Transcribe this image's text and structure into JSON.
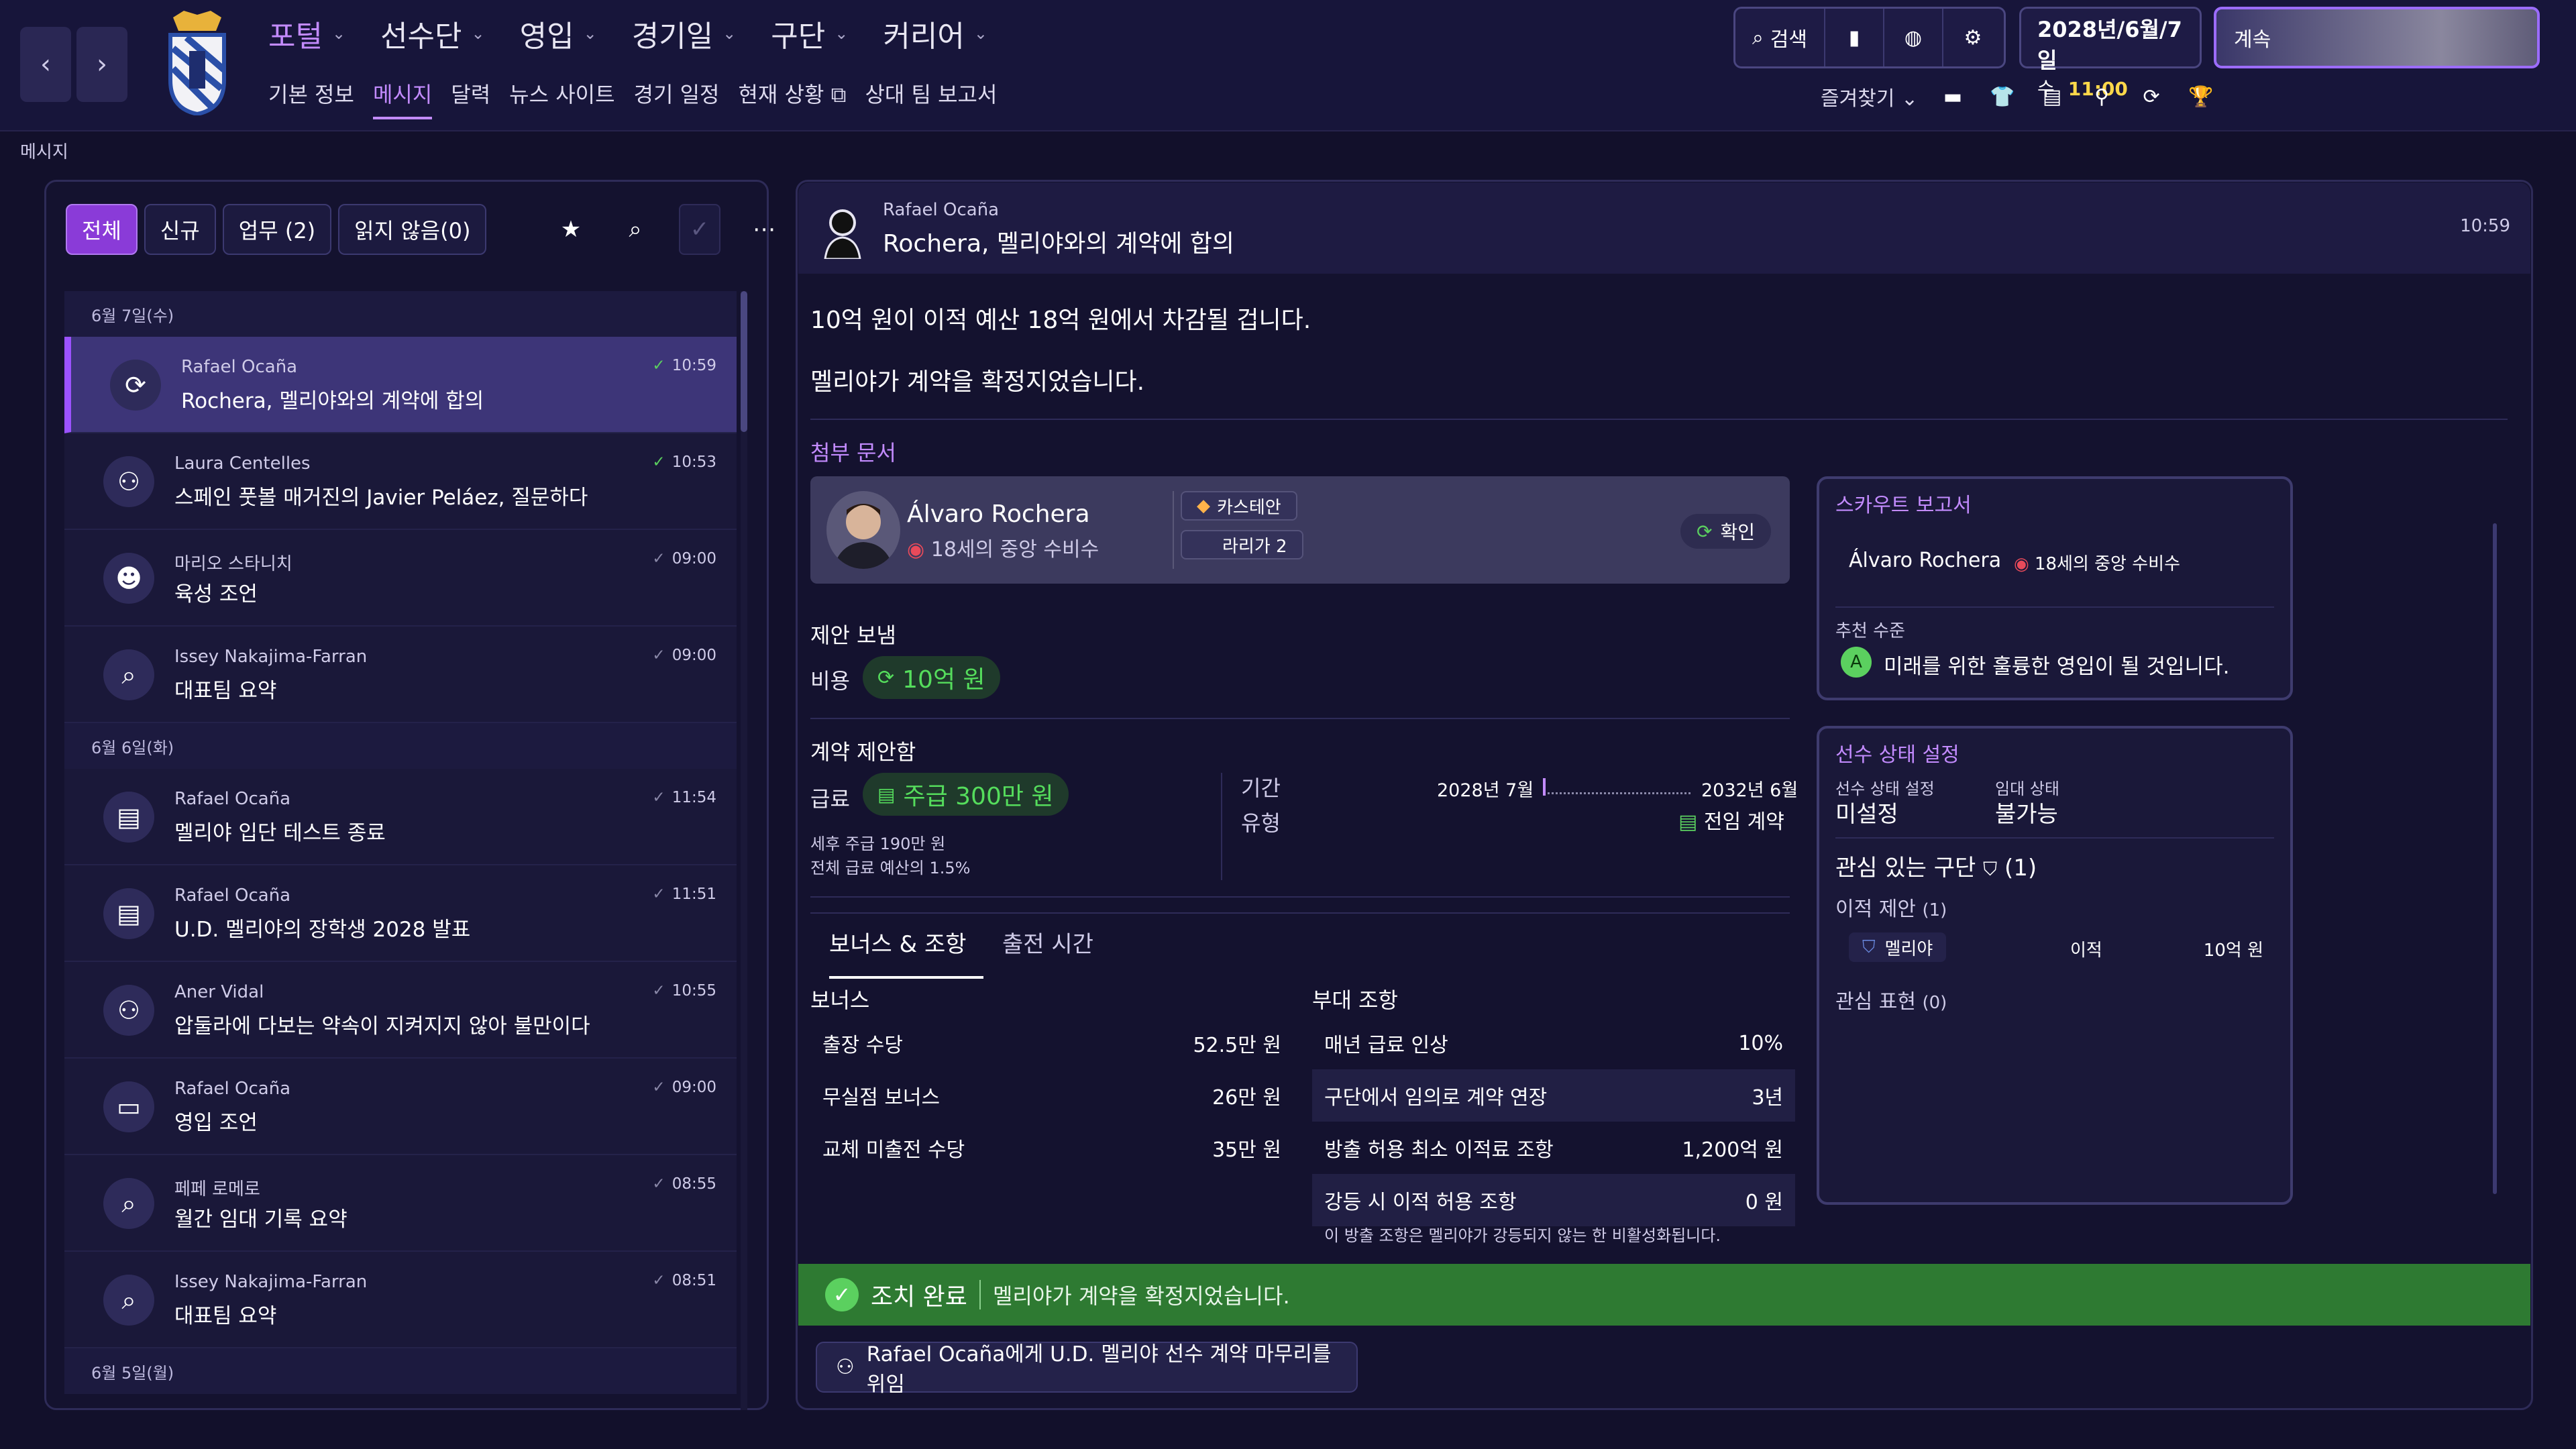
{
  "nav": {
    "back_icon": "chevron-left-icon",
    "forward_icon": "chevron-right-icon",
    "menu": [
      "포털",
      "선수단",
      "영입",
      "경기일",
      "구단",
      "커리어"
    ],
    "submenu": [
      "기본 정보",
      "메시지",
      "달력",
      "뉴스 사이트",
      "경기 일정",
      "현재 상황",
      "상대 팀 보고서"
    ],
    "search_label": "검색",
    "date": "2028년/6월/7일",
    "weekday": "수",
    "time": "11:00",
    "continue_label": "계속",
    "favorites_label": "즐겨찾기",
    "active_color": "#c38bff"
  },
  "breadcrumb": "메시지",
  "inbox": {
    "tabs": [
      "전체",
      "신규",
      "업무 (2)",
      "읽지 않음(0)"
    ],
    "days": [
      {
        "label": "6월 7일(수)",
        "items": [
          {
            "from": "Rafael Ocaña",
            "subject": "Rochera, 멜리야와의 계약에 합의",
            "time": "10:59",
            "icon": "refresh-icon",
            "read": "green",
            "selected": true
          },
          {
            "from": "Laura Centelles",
            "subject": "스페인 풋볼 매거진의 Javier Peláez, 질문하다",
            "time": "10:53",
            "icon": "press-icon",
            "read": "green"
          },
          {
            "from": "마리오 스타니치",
            "subject": "육성 조언",
            "time": "09:00",
            "icon": "group-icon",
            "read": "grey"
          },
          {
            "from": "Issey Nakajima-Farran",
            "subject": "대표팀 요약",
            "time": "09:00",
            "icon": "magnifier-icon",
            "read": "grey"
          }
        ]
      },
      {
        "label": "6월 6일(화)",
        "items": [
          {
            "from": "Rafael Ocaña",
            "subject": "멜리야 입단 테스트 종료",
            "time": "11:54",
            "icon": "document-icon",
            "read": "grey"
          },
          {
            "from": "Rafael Ocaña",
            "subject": "U.D. 멜리야의 장학생 2028 발표",
            "time": "11:51",
            "icon": "document-icon",
            "read": "grey"
          },
          {
            "from": "Aner Vidal",
            "subject": "압둘라에 다보는 약속이 지켜지지 않아 불만이다",
            "time": "10:55",
            "icon": "press-icon",
            "read": "grey"
          },
          {
            "from": "Rafael Ocaña",
            "subject": "영입 조언",
            "time": "09:00",
            "icon": "briefcase-icon",
            "read": "grey"
          },
          {
            "from": "페페 로메로",
            "subject": "월간 임대 기록 요약",
            "time": "08:55",
            "icon": "magnifier-icon",
            "read": "grey"
          },
          {
            "from": "Issey Nakajima-Farran",
            "subject": "대표팀 요약",
            "time": "08:51",
            "icon": "magnifier-icon",
            "read": "grey"
          }
        ]
      },
      {
        "label": "6월 5일(월)",
        "items": []
      }
    ]
  },
  "message": {
    "from": "Rafael Ocaña",
    "subject": "Rochera, 멜리야와의 계약에 합의",
    "time": "10:59",
    "body1": "10억 원이 이적 예산 18억 원에서 차감될 겁니다.",
    "body2": "멜리야가 계약을 확정지었습니다.",
    "attach_label": "첨부 문서",
    "player": {
      "name": "Álvaro Rochera",
      "pos": "18세의 중앙 수비수",
      "club": "카스테안",
      "league": "라리가 2",
      "confirm": "확인"
    },
    "offer_title": "제안 보냄",
    "cost_label": "비용",
    "cost_value": "10억 원",
    "contract_title": "계약 제안함",
    "wage_label": "급료",
    "wage_value": "주급 300만 원",
    "wage_note1": "세후 주급 190만 원",
    "wage_note2": "전체 급료 예산의 1.5%",
    "period_label": "기간",
    "period_from": "2028년 7월",
    "period_to": "2032년 6월",
    "type_label": "유형",
    "type_value": "전임 계약",
    "tab1": "보너스 & 조항",
    "tab2": "출전 시간",
    "bonus_title": "보너스",
    "bonuses": [
      [
        "출장 수당",
        "52.5만 원"
      ],
      [
        "무실점 보너스",
        "26만 원"
      ],
      [
        "교체 미출전 수당",
        "35만 원"
      ]
    ],
    "clauses_title": "부대 조항",
    "clauses": [
      [
        "매년 급료 인상",
        "10%"
      ],
      [
        "구단에서 임의로 계약 연장",
        "3년"
      ],
      [
        "방출 허용 최소 이적료 조항",
        "1,200억 원"
      ],
      [
        "강등 시 이적 허용 조항",
        "0 원"
      ]
    ],
    "clause_note": "이 방출 조항은 멜리야가 강등되지 않는 한 비활성화됩니다."
  },
  "scout": {
    "title": "스카우트 보고서",
    "name": "Álvaro Rochera",
    "pos": "18세의 중앙 수비수",
    "rec_label": "추천 수준",
    "rec_grade": "A",
    "rec_text": "미래를 위한 훌륭한 영입이 될 것입니다."
  },
  "status": {
    "title": "선수 상태 설정",
    "s1_label": "선수 상태 설정",
    "s1_value": "미설정",
    "s2_label": "임대 상태",
    "s2_value": "불가능",
    "interested": "관심 있는 구단",
    "interested_count": "(1)",
    "offers": "이적 제안",
    "offers_count": "(1)",
    "offer_club": "멜리야",
    "offer_type": "이적",
    "offer_fee": "10억 원",
    "interest": "관심 표현",
    "interest_count": "(0)"
  },
  "footer": {
    "done": "조치 완료",
    "done_text": "멜리야가 계약을 확정지었습니다.",
    "delegate": "Rafael Ocaña에게 U.D. 멜리야 선수 계약 마무리를 위임"
  }
}
